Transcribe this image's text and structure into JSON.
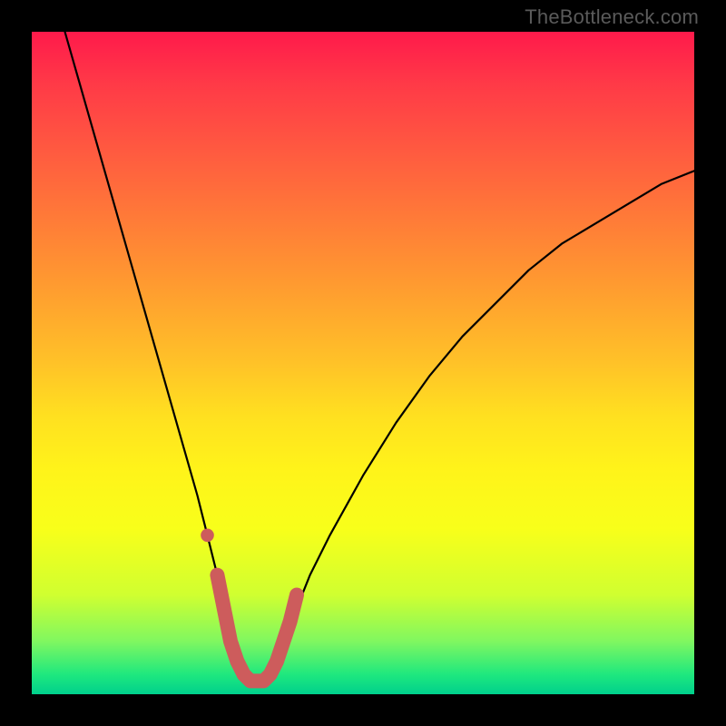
{
  "attribution": "TheBottleneck.com",
  "chart_data": {
    "type": "line",
    "title": "",
    "xlabel": "",
    "ylabel": "",
    "xlim": [
      0,
      100
    ],
    "ylim": [
      0,
      100
    ],
    "series": [
      {
        "name": "bottleneck-curve",
        "x": [
          5,
          7,
          9,
          11,
          13,
          15,
          17,
          19,
          21,
          23,
          25,
          26.5,
          28,
          29,
          30,
          31,
          32,
          33,
          34,
          35,
          36,
          37,
          38,
          40,
          42,
          45,
          50,
          55,
          60,
          65,
          70,
          75,
          80,
          85,
          90,
          95,
          100
        ],
        "values": [
          100,
          93,
          86,
          79,
          72,
          65,
          58,
          51,
          44,
          37,
          30,
          24,
          18,
          13,
          8,
          5,
          3,
          2,
          2,
          2,
          3,
          5,
          8,
          13,
          18,
          24,
          33,
          41,
          48,
          54,
          59,
          64,
          68,
          71,
          74,
          77,
          79
        ]
      }
    ],
    "markers": [
      {
        "name": "highlight-start-dot",
        "x": 26.5,
        "y": 24,
        "r": 1.0,
        "color": "#cd5c5c"
      },
      {
        "name": "highlight-trough",
        "style": "thick-stroke",
        "color": "#cd5c5c",
        "x": [
          28,
          29,
          30,
          31,
          32,
          33,
          34,
          35,
          36,
          37,
          38,
          39,
          40
        ],
        "values": [
          18,
          13,
          8,
          5,
          3,
          2,
          2,
          2,
          3,
          5,
          8,
          11,
          15
        ]
      }
    ],
    "background_gradient": {
      "direction": "vertical",
      "stops": [
        {
          "pos": 0.0,
          "color": "#ff1a4b"
        },
        {
          "pos": 0.5,
          "color": "#ffc228"
        },
        {
          "pos": 0.75,
          "color": "#f8ff1a"
        },
        {
          "pos": 1.0,
          "color": "#00d08c"
        }
      ]
    }
  }
}
